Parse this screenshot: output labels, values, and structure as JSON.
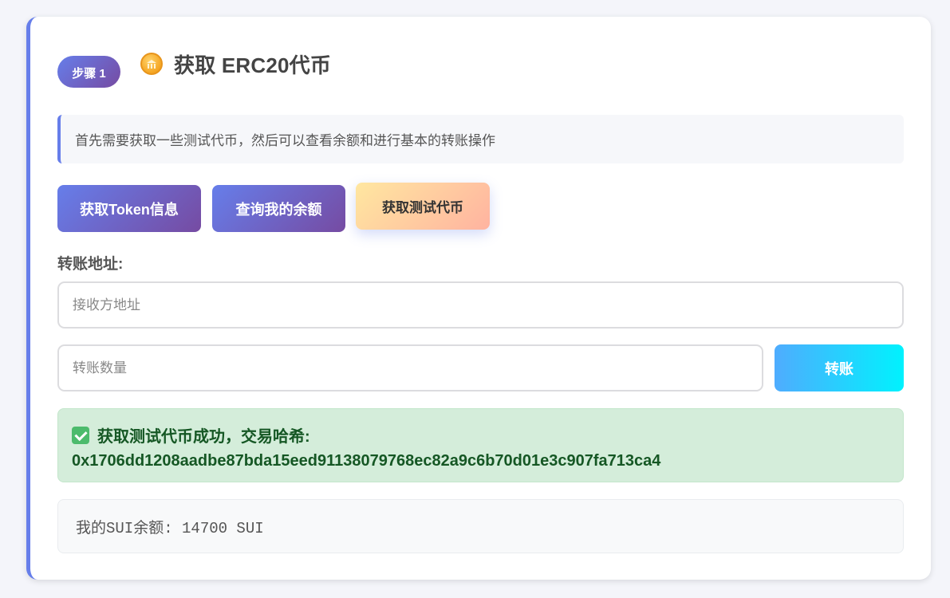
{
  "step": {
    "badge": "步骤 1",
    "icon": "coin-bank-icon",
    "title": "获取 ERC20代币"
  },
  "info": {
    "text": "首先需要获取一些测试代币，然后可以查看余额和进行基本的转账操作"
  },
  "buttons": {
    "token_info": "获取Token信息",
    "my_balance": "查询我的余额",
    "faucet": "获取测试代币",
    "transfer": "转账"
  },
  "transfer": {
    "label": "转账地址:",
    "address_placeholder": "接收方地址",
    "amount_placeholder": "转账数量"
  },
  "result": {
    "message": "获取测试代币成功，交易哈希:",
    "hash": "0x1706dd1208aadbe87bda15eed91138079768ec82a9c6b70d01e3c907fa713ca4"
  },
  "balance": {
    "text": "我的SUI余额: 14700 SUI"
  },
  "colors": {
    "accent": "#667eea",
    "accent_end": "#764ba2",
    "success_bg": "#d4edda",
    "success_text": "#155724",
    "transfer_start": "#4facfe",
    "transfer_end": "#00f2fe"
  }
}
